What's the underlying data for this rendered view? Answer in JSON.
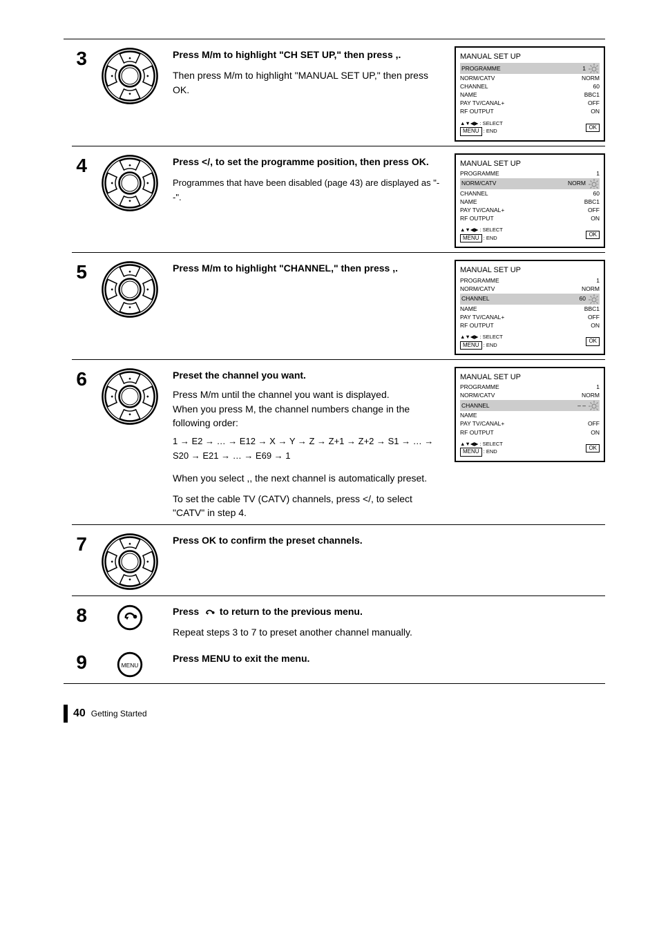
{
  "steps": {
    "s3": {
      "num": "3",
      "body_bold_pre": "Press ",
      "body_bold_key1": "M/m",
      "body_bold_mid": " to highlight \"CH SET UP,\" then press ",
      "body_bold_key2": ",",
      "body_bold_post": ".",
      "body2_pre": "Then press ",
      "body2_key": "M/m",
      "body2_post": " to highlight \"MANUAL SET UP,\" then press OK.",
      "box": {
        "title": "MANUAL SET UP",
        "lines": [
          {
            "l": "PROGRAMME",
            "r": "1",
            "hl": true
          },
          {
            "l": "NORM/CATV",
            "r": "NORM",
            "hl": false
          },
          {
            "l": "CHANNEL",
            "r": "60",
            "hl": false
          },
          {
            "l": "NAME",
            "r": "BBC1",
            "hl": false
          },
          {
            "l": "PAY TV/CANAL+",
            "r": "OFF",
            "hl": false
          },
          {
            "l": "RF OUTPUT",
            "r": "ON",
            "hl": false
          }
        ],
        "legend_l1": "SELECT",
        "legend_l2": "END",
        "ok": "OK"
      }
    },
    "s4": {
      "num": "4",
      "body_pre": "Press ",
      "body_key": "</,",
      "body_mid": " to set the programme position, then press OK.",
      "body_note": "Programmes that have been disabled (page 43) are displayed as \"- -\".",
      "box": {
        "title": "MANUAL SET UP",
        "lines": [
          {
            "l": "PROGRAMME",
            "r": "1",
            "hl": false
          },
          {
            "l": "NORM/CATV",
            "r": "NORM",
            "hl": true
          },
          {
            "l": "CHANNEL",
            "r": "60",
            "hl": false
          },
          {
            "l": "NAME",
            "r": "BBC1",
            "hl": false
          },
          {
            "l": "PAY TV/CANAL+",
            "r": "OFF",
            "hl": false
          },
          {
            "l": "RF OUTPUT",
            "r": "ON",
            "hl": false
          }
        ],
        "legend_l1": "SELECT",
        "legend_l2": "END",
        "ok": "OK"
      }
    },
    "s5": {
      "num": "5",
      "body_pre": "Press ",
      "body_key1": "M/m",
      "body_mid1": " to highlight \"CHANNEL,\" then press ",
      "body_key2": ",",
      "body_post": ".",
      "box": {
        "title": "MANUAL SET UP",
        "lines": [
          {
            "l": "PROGRAMME",
            "r": "1",
            "hl": false
          },
          {
            "l": "NORM/CATV",
            "r": "NORM",
            "hl": false
          },
          {
            "l": "CHANNEL",
            "r": "60",
            "hl": true
          },
          {
            "l": "NAME",
            "r": "BBC1",
            "hl": false
          },
          {
            "l": "PAY TV/CANAL+",
            "r": "OFF",
            "hl": false
          },
          {
            "l": "RF OUTPUT",
            "r": "ON",
            "hl": false
          }
        ],
        "legend_l1": "SELECT",
        "legend_l2": "END",
        "ok": "OK"
      }
    },
    "s6": {
      "num": "6",
      "body_l1_pre": "Preset the channel you want.",
      "body_l2_pre": "Press ",
      "body_l2_key": "M/m",
      "body_l2_post": " until the channel you want is displayed.",
      "body_l3_pre": "When you press ",
      "body_l3_key": "M",
      "body_l3_post": ", the channel numbers change in the following order:",
      "seq": "1 → E2 → … → E12 → X → Y → Z → Z+1 → Z+2 → S1 → … → S20 → E21 → … → E69 → 1",
      "body_l4_pre": "When you select ",
      "body_l4_key": ",",
      "body_l4_post": ", the next channel is automatically preset.",
      "body_l5_pre": "To set the cable TV (CATV) channels, press ",
      "body_l5_key": "</,",
      "body_l5_post": " to select \"CATV\" in step 4.",
      "box": {
        "title": "MANUAL SET UP",
        "lines": [
          {
            "l": "PROGRAMME",
            "r": "1",
            "hl": false
          },
          {
            "l": "NORM/CATV",
            "r": "NORM",
            "hl": false
          },
          {
            "l": "CHANNEL",
            "r": "– –",
            "hl": true
          },
          {
            "l": "NAME",
            "r": "",
            "hl": false
          },
          {
            "l": "PAY TV/CANAL+",
            "r": "OFF",
            "hl": false
          },
          {
            "l": "RF OUTPUT",
            "r": "ON",
            "hl": false
          }
        ],
        "legend_l1": "SELECT",
        "legend_l2": "END",
        "ok": "OK"
      }
    },
    "s7": {
      "num": "7",
      "body": "Press OK to confirm the preset channels."
    },
    "s8": {
      "num": "8",
      "body_pre": "Press ",
      "body_icon": "return-icon",
      "body_post": " to return to the previous menu.",
      "body2": "Repeat steps 3 to 7 to preset another channel manually."
    },
    "s9": {
      "num": "9",
      "body": "Press MENU to exit the menu."
    }
  },
  "footer": {
    "pagenum": "40",
    "chapter": "Getting Started"
  },
  "icons": {
    "sun_alt": "highlight-cursor",
    "legend_arrows": "▲▼◀▶"
  }
}
